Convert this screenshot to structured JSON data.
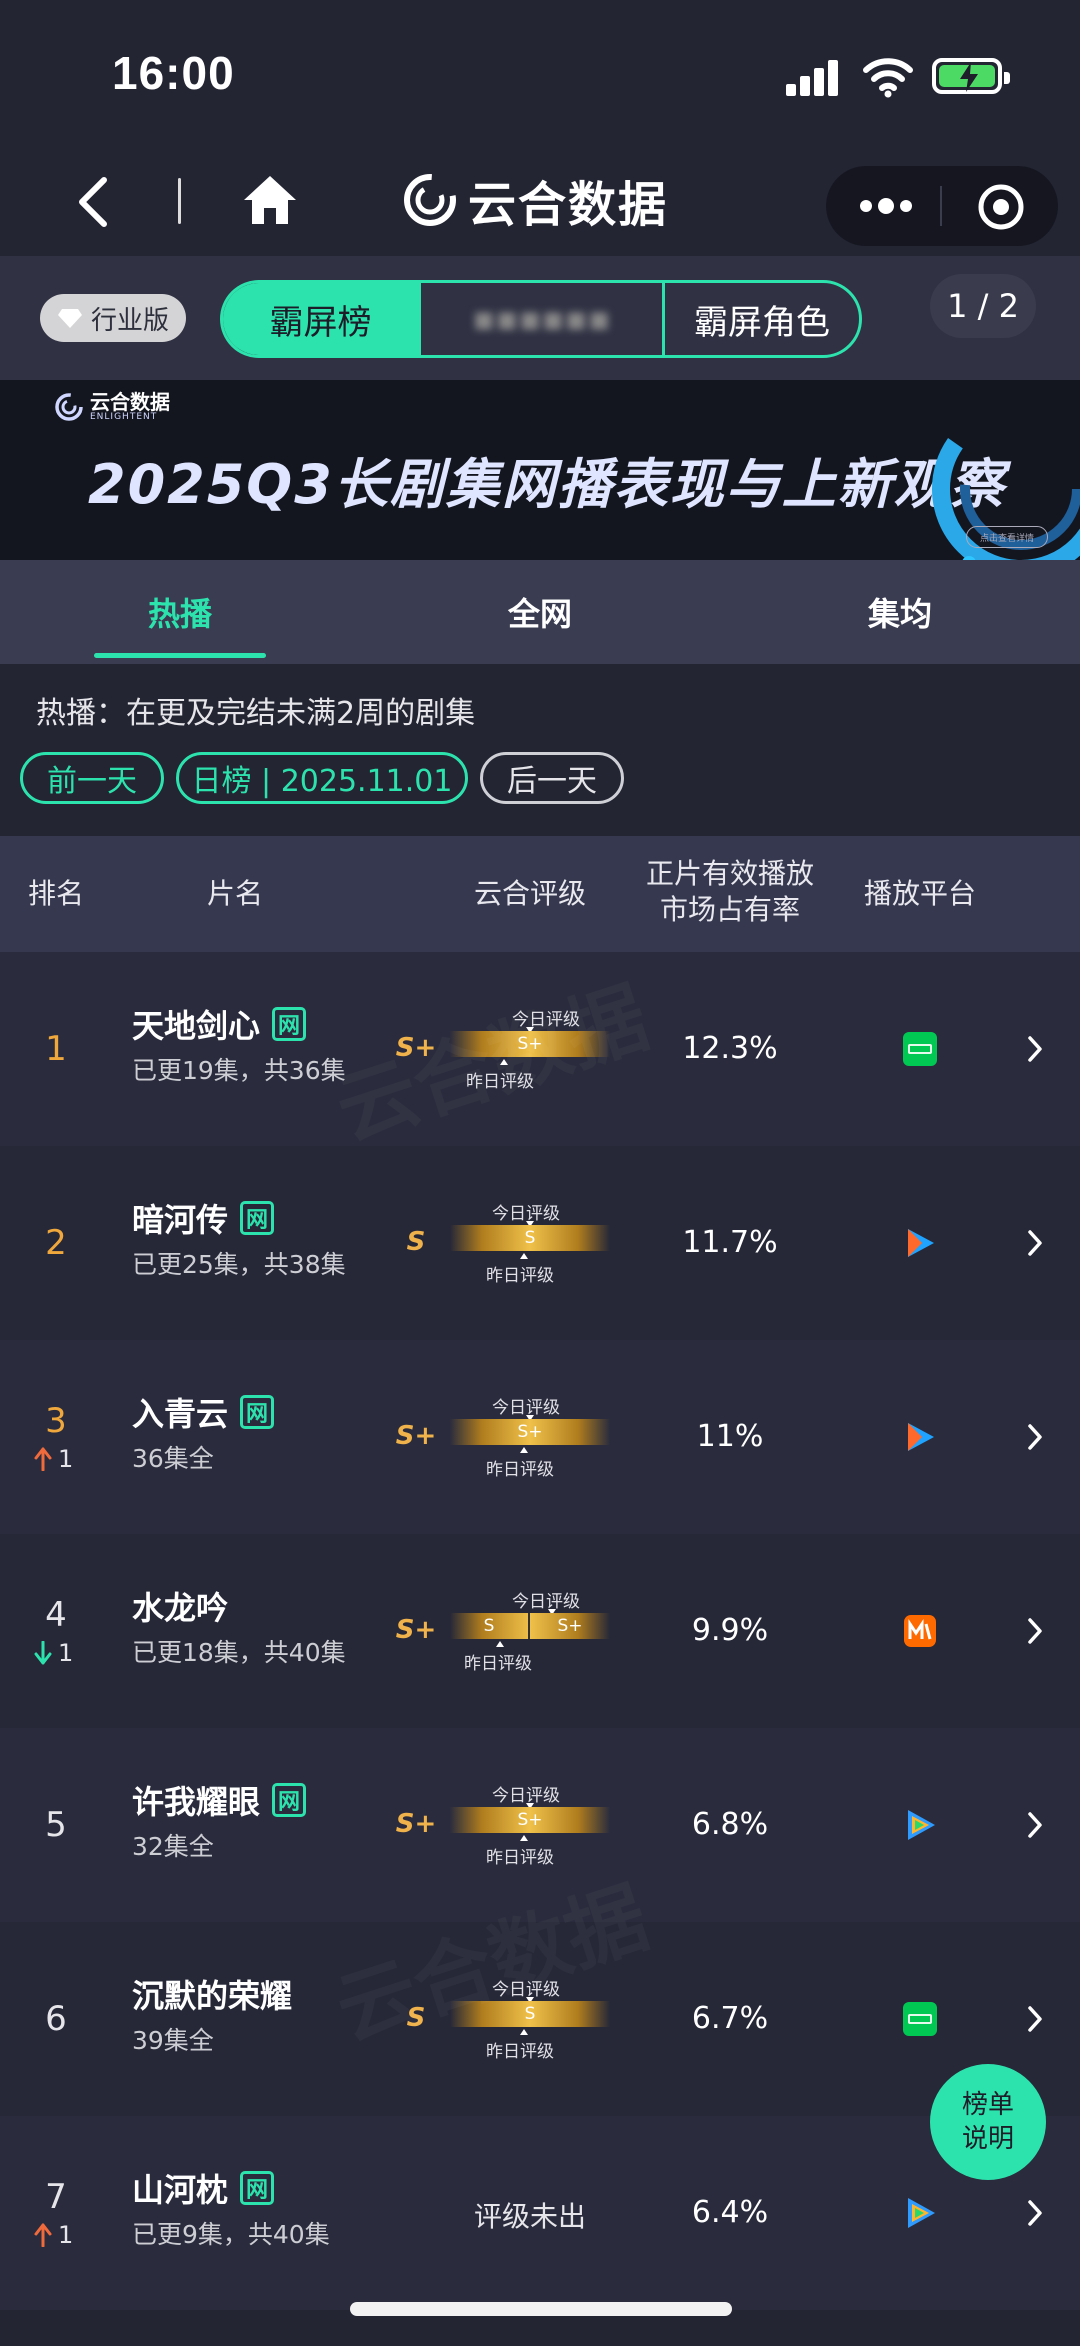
{
  "status_bar": {
    "time": "16:00"
  },
  "nav": {
    "app_title": "云合数据"
  },
  "top_tabs": {
    "edition_badge": "行业版",
    "items": [
      "霸屏榜",
      "",
      "霸屏角色"
    ],
    "pager": "1 / 2"
  },
  "banner": {
    "logo_cn": "云合数据",
    "logo_en": "ENLIGHTENT",
    "title": "2025Q3长剧集网播表现与上新观察",
    "button": "点击查看详情"
  },
  "main_tabs": [
    "热播",
    "全网",
    "集均"
  ],
  "description": "热播：在更及完结未满2周的剧集",
  "date_controls": {
    "prev": "前一天",
    "current": "日榜 | 2025.11.01",
    "next": "后一天"
  },
  "table_header": {
    "rank": "排名",
    "name": "片名",
    "rating": "云合评级",
    "share_line1": "正片有效播放",
    "share_line2": "市场占有率",
    "platform": "播放平台"
  },
  "gauge_labels": {
    "today": "今日评级",
    "yesterday": "昨日评级"
  },
  "rows": [
    {
      "rank": "1",
      "change": "",
      "change_dir": "",
      "title": "天地剑心",
      "tag": "网",
      "sub": "已更19集，共36集",
      "grade": "S+",
      "gauge": [
        "S+"
      ],
      "share": "12.3%",
      "platform": "iqiyi"
    },
    {
      "rank": "2",
      "change": "",
      "change_dir": "",
      "title": "暗河传",
      "tag": "网",
      "sub": "已更25集，共38集",
      "grade": "S",
      "gauge": [
        "S"
      ],
      "share": "11.7%",
      "platform": "youku"
    },
    {
      "rank": "3",
      "change": "1",
      "change_dir": "up",
      "title": "入青云",
      "tag": "网",
      "sub": "36集全",
      "grade": "S+",
      "gauge": [
        "S+"
      ],
      "share": "11%",
      "platform": "youku"
    },
    {
      "rank": "4",
      "change": "1",
      "change_dir": "down",
      "title": "水龙吟",
      "tag": "",
      "sub": "已更18集，共40集",
      "grade": "S+",
      "gauge": [
        "S",
        "S+"
      ],
      "share": "9.9%",
      "platform": "mgtv"
    },
    {
      "rank": "5",
      "change": "",
      "change_dir": "",
      "title": "许我耀眼",
      "tag": "网",
      "sub": "32集全",
      "grade": "S+",
      "gauge": [
        "S+"
      ],
      "share": "6.8%",
      "platform": "tencent"
    },
    {
      "rank": "6",
      "change": "",
      "change_dir": "",
      "title": "沉默的荣耀",
      "tag": "",
      "sub": "39集全",
      "grade": "S",
      "gauge": [
        "S"
      ],
      "share": "6.7%",
      "platform": "iqiyi"
    },
    {
      "rank": "7",
      "change": "1",
      "change_dir": "up",
      "title": "山河枕",
      "tag": "网",
      "sub": "已更9集，共40集",
      "grade": "",
      "gauge": [],
      "no_grade": "评级未出",
      "share": "6.4%",
      "platform": "tencent"
    }
  ],
  "fab": {
    "line1": "榜单",
    "line2": "说明"
  },
  "platform_icons": {
    "iqiyi": "iqiyi-icon",
    "youku": "youku-icon",
    "mgtv": "mgtv-icon",
    "tencent": "tencent-video-icon"
  },
  "colors": {
    "accent": "#2de3ad",
    "grade": "#f0b24a",
    "up": "#f06a3c",
    "down": "#2de3ad"
  }
}
